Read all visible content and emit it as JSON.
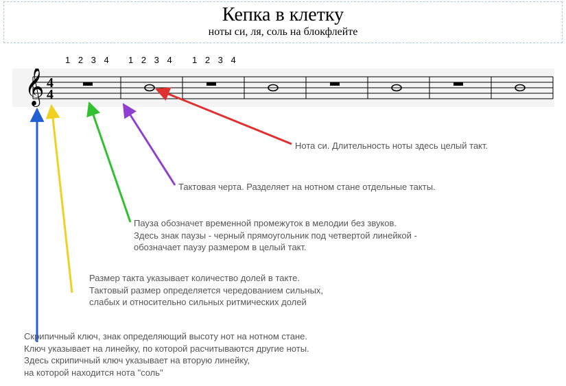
{
  "header": {
    "title": "Кепка в клетку",
    "subtitle": "ноты си, ля, соль на блокфлейте"
  },
  "beats": {
    "group1": "1 2 3 4",
    "group2": "1 2 3 4",
    "group3": "1 2 3 4"
  },
  "staff": {
    "time_signature_top": "4",
    "time_signature_bottom": "4",
    "measures": 8,
    "pattern": [
      "rest",
      "note",
      "rest",
      "note",
      "rest",
      "note",
      "rest",
      "note"
    ],
    "note_pitch": "B4"
  },
  "annotations": {
    "note_b": "Нота си. Длительность ноты здесь целый такт.",
    "barline": "Тактовая черта. Разделяет на нотном стане отдельные такты.",
    "rest": "Пауза обозначет временной промежуток в мелодии без звуков.\nЗдесь знак паузы - черный прямоугольник под четвертой линейкой -\nобозначает паузу размером в целый такт.",
    "time_sig": "Размер такта указывает количество долей в такте.\nТактовый размер определяется чередованием сильных,\nслабых и относительно сильных ритмических долей",
    "clef": "Скрипичный ключ, знак определяющий высоту нот на нотном стане.\nКлюч указывает на линейку, по которой расчитываются другие ноты.\nЗдесь скрипичный ключ указывает на вторую линейку,\nна которой находится нота \"соль\""
  },
  "colors": {
    "blue": "#2060d0",
    "yellow": "#f0d020",
    "green": "#30c030",
    "purple": "#9040d0",
    "red": "#e03030"
  }
}
